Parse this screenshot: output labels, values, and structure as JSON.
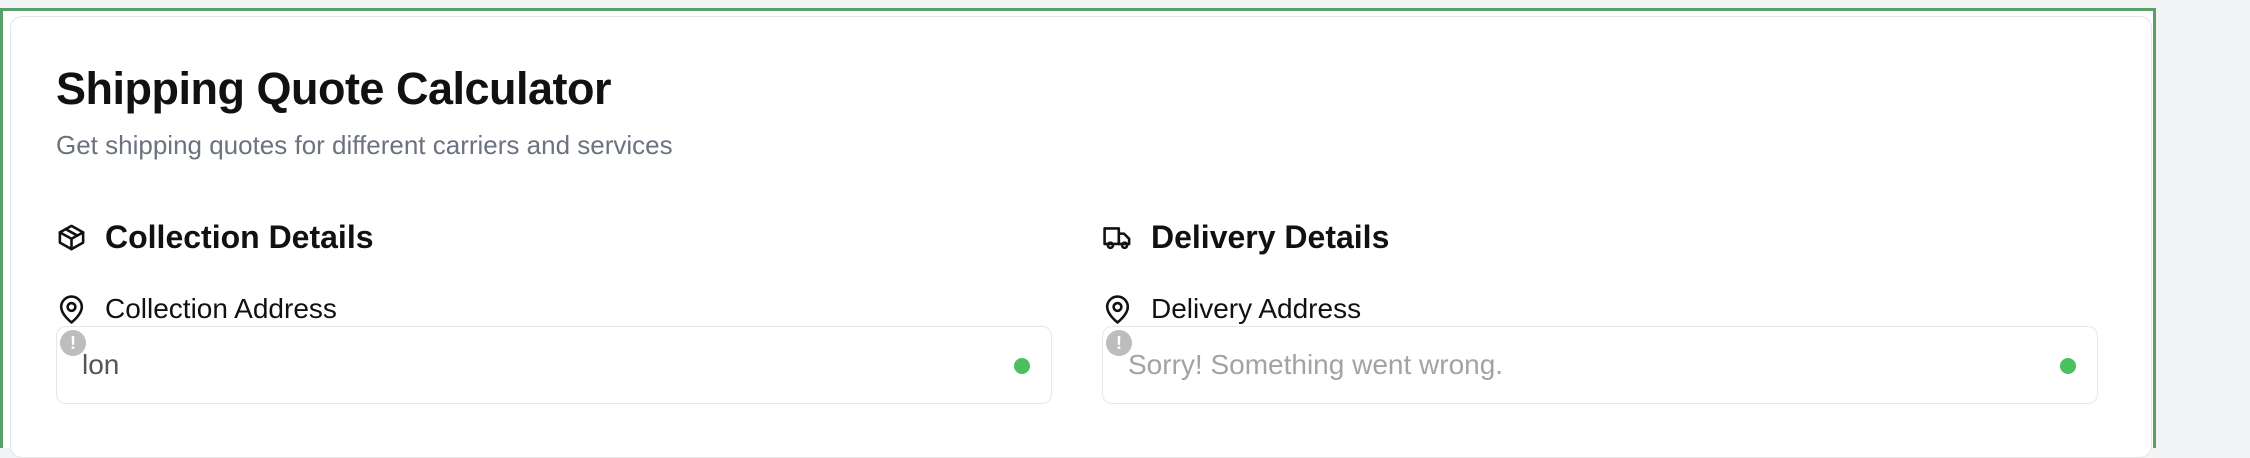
{
  "header": {
    "title": "Shipping Quote Calculator",
    "subtitle": "Get shipping quotes for different carriers and services"
  },
  "collection": {
    "section_title": "Collection Details",
    "section_icon": "package-icon",
    "address_label": "Collection Address",
    "address_icon": "map-pin-icon",
    "address_value": "lon",
    "alert_icon": "alert-icon",
    "alert_glyph": "!",
    "status_color": "#4bc05f"
  },
  "delivery": {
    "section_title": "Delivery Details",
    "section_icon": "truck-icon",
    "address_label": "Delivery Address",
    "address_icon": "map-pin-icon",
    "address_value": "Sorry! Something went wrong.",
    "alert_icon": "alert-icon",
    "alert_glyph": "!",
    "status_color": "#4bc05f"
  },
  "theme": {
    "frame_border": "#58a06a",
    "accent_green": "#4bc05f"
  }
}
